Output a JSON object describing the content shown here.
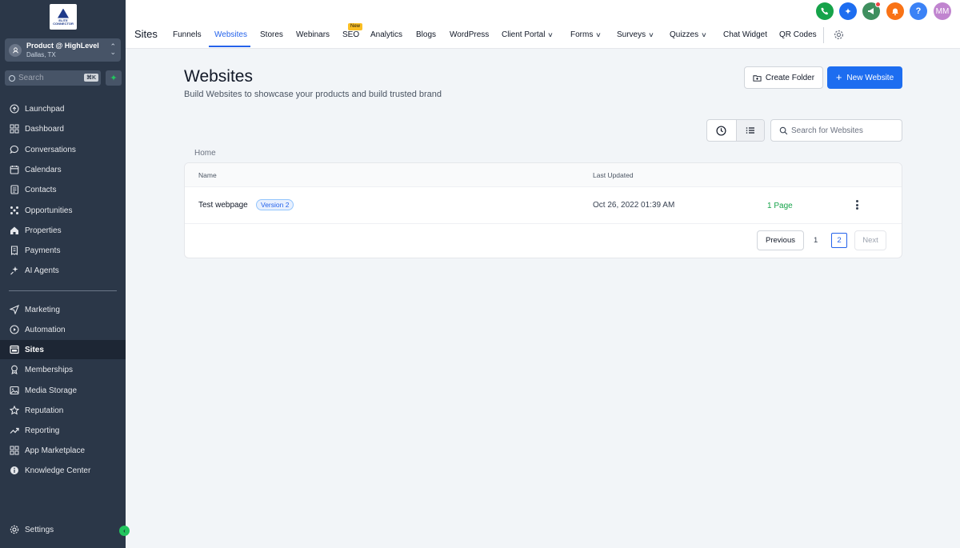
{
  "sidebar": {
    "logo_text": "ELITE CONNECTOR",
    "account": {
      "name": "Product @ HighLevel",
      "location": "Dallas, TX"
    },
    "search": {
      "placeholder": "Search",
      "shortcut": "⌘K"
    },
    "items": [
      {
        "label": "Launchpad",
        "icon": "launchpad-icon"
      },
      {
        "label": "Dashboard",
        "icon": "grid-icon"
      },
      {
        "label": "Conversations",
        "icon": "chat-icon"
      },
      {
        "label": "Calendars",
        "icon": "calendar-icon"
      },
      {
        "label": "Contacts",
        "icon": "contacts-icon"
      },
      {
        "label": "Opportunities",
        "icon": "opportunities-icon"
      },
      {
        "label": "Properties",
        "icon": "home-icon"
      },
      {
        "label": "Payments",
        "icon": "receipt-icon"
      },
      {
        "label": "AI Agents",
        "icon": "sparkle-icon"
      },
      {
        "label": "Marketing",
        "icon": "send-icon"
      },
      {
        "label": "Automation",
        "icon": "automation-icon"
      },
      {
        "label": "Sites",
        "icon": "sites-icon",
        "active": true
      },
      {
        "label": "Memberships",
        "icon": "badge-icon"
      },
      {
        "label": "Media Storage",
        "icon": "image-icon"
      },
      {
        "label": "Reputation",
        "icon": "star-icon"
      },
      {
        "label": "Reporting",
        "icon": "trend-icon"
      },
      {
        "label": "App Marketplace",
        "icon": "apps-icon"
      },
      {
        "label": "Knowledge Center",
        "icon": "info-icon"
      }
    ],
    "settings_label": "Settings"
  },
  "topbar": {
    "section_title": "Sites",
    "tabs": [
      {
        "label": "Funnels"
      },
      {
        "label": "Websites",
        "active": true
      },
      {
        "label": "Stores"
      },
      {
        "label": "Webinars"
      },
      {
        "label": "SEO",
        "badge": "New"
      },
      {
        "label": "Analytics"
      },
      {
        "label": "Blogs"
      },
      {
        "label": "WordPress"
      },
      {
        "label": "Client Portal",
        "dropdown": true
      },
      {
        "label": "Forms",
        "dropdown": true
      },
      {
        "label": "Surveys",
        "dropdown": true
      },
      {
        "label": "Quizzes",
        "dropdown": true
      },
      {
        "label": "Chat Widget"
      },
      {
        "label": "QR Codes"
      }
    ],
    "user_initials": "MM",
    "help_symbol": "?",
    "colors": {
      "phone": "#16a34a",
      "ai": "#1d6df0",
      "announce": "#3f8f5f",
      "bell": "#f97316",
      "help": "#3b82f6",
      "avatar": "#c084cf"
    }
  },
  "main": {
    "title": "Websites",
    "subtitle": "Build Websites to showcase your products and build trusted brand",
    "create_folder_label": "Create Folder",
    "new_website_label": "New Website",
    "search_placeholder": "Search for Websites",
    "breadcrumb": "Home",
    "table": {
      "headers": {
        "name": "Name",
        "updated": "Last Updated"
      },
      "rows": [
        {
          "name": "Test webpage",
          "version": "Version 2",
          "updated": "Oct 26, 2022 01:39 AM",
          "pages": "1 Page"
        }
      ]
    },
    "pagination": {
      "previous": "Previous",
      "page1": "1",
      "page2": "2",
      "next": "Next",
      "current": 2
    }
  }
}
